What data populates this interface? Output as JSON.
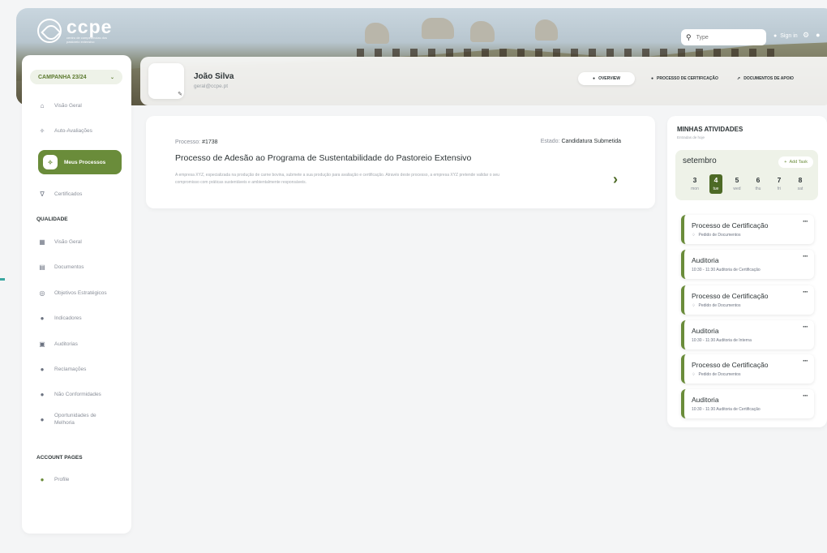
{
  "brand": {
    "name": "ccpe",
    "tagline": "centro de competências dos pastoreio extensivo"
  },
  "search": {
    "placeholder": "Type"
  },
  "header": {
    "signin": "Sign in"
  },
  "sidebar": {
    "campaign": "CAMPANHA 23/24",
    "items": [
      {
        "label": "Visão Geral"
      },
      {
        "label": "Auto-Avaliações"
      },
      {
        "label": "Meus Processos"
      },
      {
        "label": "Certificados"
      }
    ],
    "quality_title": "QUALIDADE",
    "quality_items": [
      {
        "label": "Visão Geral"
      },
      {
        "label": "Documentos"
      },
      {
        "label": "Objetivos Estratégicos"
      },
      {
        "label": "Indicadores"
      },
      {
        "label": "Auditorias"
      },
      {
        "label": "Reclamações"
      },
      {
        "label": "Não Conformidades"
      },
      {
        "label": "Oportunidades de Melhoria"
      }
    ],
    "account_title": "ACCOUNT PAGES",
    "account_items": [
      {
        "label": "Profile"
      }
    ]
  },
  "profile": {
    "name": "João Silva",
    "email": "geral@ccpe.pt",
    "tabs": [
      {
        "label": "OVERVIEW"
      },
      {
        "label": "PROCESSO DE CERTIFICAÇÃO"
      },
      {
        "label": "DOCUMENTOS DE APOIO"
      }
    ]
  },
  "process": {
    "number_label": "Processo:",
    "number": "#1738",
    "state_label": "Estado:",
    "state": "Candidatura Submetida",
    "title": "Processo de Adesão ao Programa de Sustentabilidade do Pastoreio Extensivo",
    "description": "A empresa XYZ, especializada na produção de carne bovina, submete a sua produção para avaliação e certificação. Através deste processo, a empresa XYZ pretende validar o seu compromisso com práticas sustentáveis e ambientalmente responsáveis."
  },
  "activities": {
    "title": "MINHAS ATIVIDADES",
    "subtitle": "Entradas de hoje",
    "month": "setembro",
    "add_label": "Add Task",
    "days": [
      {
        "n": "3",
        "w": "mon"
      },
      {
        "n": "4",
        "w": "tue"
      },
      {
        "n": "5",
        "w": "wed"
      },
      {
        "n": "6",
        "w": "thu"
      },
      {
        "n": "7",
        "w": "fri"
      },
      {
        "n": "8",
        "w": "sat"
      }
    ],
    "items": [
      {
        "title": "Processo de Certificação",
        "sub": "Pedido de Documentos"
      },
      {
        "title": "Auditoria",
        "sub": "10:30 - 11:30 Auditoria de Certificação"
      },
      {
        "title": "Processo de Certificação",
        "sub": "Pedido de Documentos"
      },
      {
        "title": "Auditoria",
        "sub": "10:30 - 11:30 Auditoria de Interna"
      },
      {
        "title": "Processo de Certificação",
        "sub": "Pedido de Documentos"
      },
      {
        "title": "Auditoria",
        "sub": "10:30 - 11:30 Auditoria de Certificação"
      }
    ]
  }
}
